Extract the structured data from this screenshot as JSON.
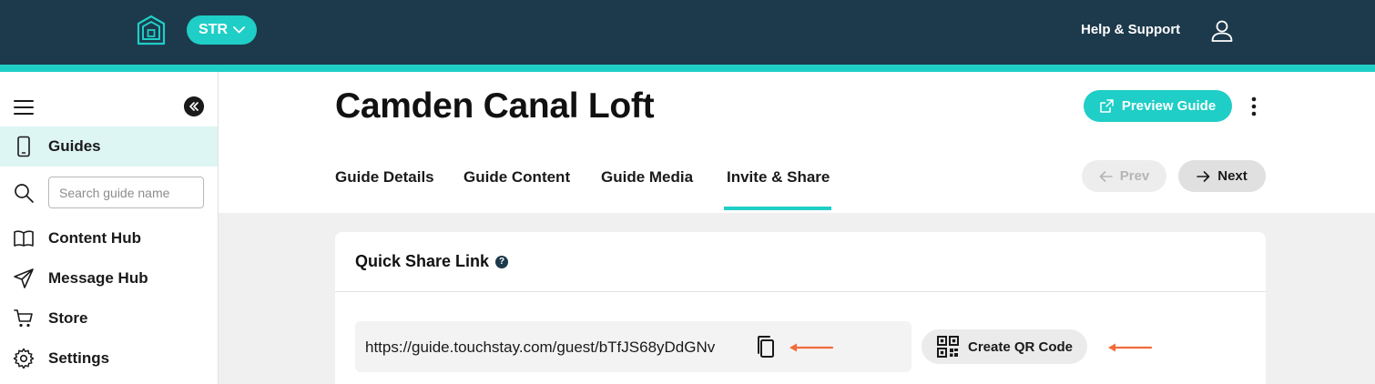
{
  "topbar": {
    "env_label": "STR",
    "help_label": "Help & Support"
  },
  "sidebar": {
    "items": [
      {
        "label": "Guides",
        "icon": "phone-icon",
        "active": true
      },
      {
        "label": "Content Hub",
        "icon": "book-icon"
      },
      {
        "label": "Message Hub",
        "icon": "send-icon"
      },
      {
        "label": "Store",
        "icon": "cart-icon"
      },
      {
        "label": "Settings",
        "icon": "gear-icon"
      }
    ],
    "search": {
      "placeholder": "Search guide name"
    }
  },
  "header": {
    "title": "Camden Canal Loft",
    "preview_label": "Preview Guide",
    "tabs": [
      {
        "label": "Guide Details"
      },
      {
        "label": "Guide Content"
      },
      {
        "label": "Guide Media"
      },
      {
        "label": "Invite & Share",
        "active": true
      }
    ],
    "prev_label": "Prev",
    "next_label": "Next"
  },
  "card": {
    "title": "Quick Share Link",
    "link": "https://guide.touchstay.com/guest/bTfJS68yDdGNv",
    "qr_label": "Create QR Code"
  },
  "colors": {
    "navy": "#1d3a4c",
    "teal": "#1fcec6",
    "annotation_arrow": "#f26b3a"
  }
}
